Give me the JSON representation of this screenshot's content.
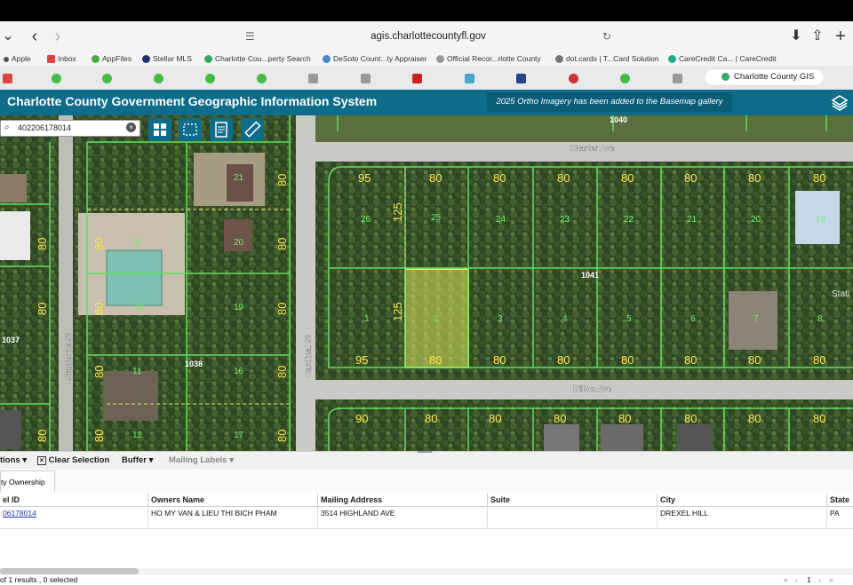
{
  "browser": {
    "url": "agis.charlottecountyfl.gov",
    "bookmarks": [
      "Apple",
      "Inbox",
      "AppFiles",
      "Stellar MLS",
      "Charlotte Cou...perty Search",
      "DeSoto Count...ty Appraiser",
      "Official Recor...rlotte County",
      "dot.cards | T...Card Solution",
      "CareCredit Ca... | CareCredit"
    ],
    "active_tab": "Charlotte County GIS"
  },
  "gis": {
    "title": "Charlotte County Government Geographic Information System",
    "notice": "2025 Ortho Imagery has been added to the Basemap gallery",
    "search_value": "402206178014"
  },
  "map": {
    "streets": [
      "Charter Ave",
      "Dillon Ave",
      "Cardinal St",
      "Stanhope St"
    ],
    "blocks": [
      "1040",
      "1041",
      "1037",
      "1038"
    ],
    "lots_top": [
      "26",
      "25",
      "24",
      "23",
      "22",
      "21",
      "20",
      "19"
    ],
    "lots_bottom": [
      "1",
      "2",
      "3",
      "4",
      "5",
      "6",
      "7",
      "8"
    ],
    "left_lots": [
      "21",
      "20",
      "9",
      "19",
      "10",
      "11",
      "16",
      "12",
      "17"
    ],
    "dims": [
      "95",
      "80",
      "125",
      "90"
    ],
    "highlighted_lot": "2",
    "partial_label": "Stati"
  },
  "actions": {
    "options": "tions",
    "clear": "Clear Selection",
    "buffer": "Buffer",
    "labels": "Mailing Labels"
  },
  "results": {
    "tab": "ty Ownership",
    "headers": [
      "el ID",
      "Owners Name",
      "Mailing Address",
      "Suite",
      "City",
      "State"
    ],
    "row": [
      "06178014",
      "HO MY VAN & LIEU THI BICH PHAM",
      "3514 HIGHLAND AVE",
      "",
      "DREXEL HILL",
      "PA"
    ],
    "status": "of 1 results , 0 selected",
    "pager": "1"
  },
  "colors": {
    "accent": "#0e6d8b",
    "parcel_line": "#5ee05e",
    "dim_text": "#ffe84a",
    "lot_text": "#6cf06c",
    "highlight": "#e8f26a"
  }
}
